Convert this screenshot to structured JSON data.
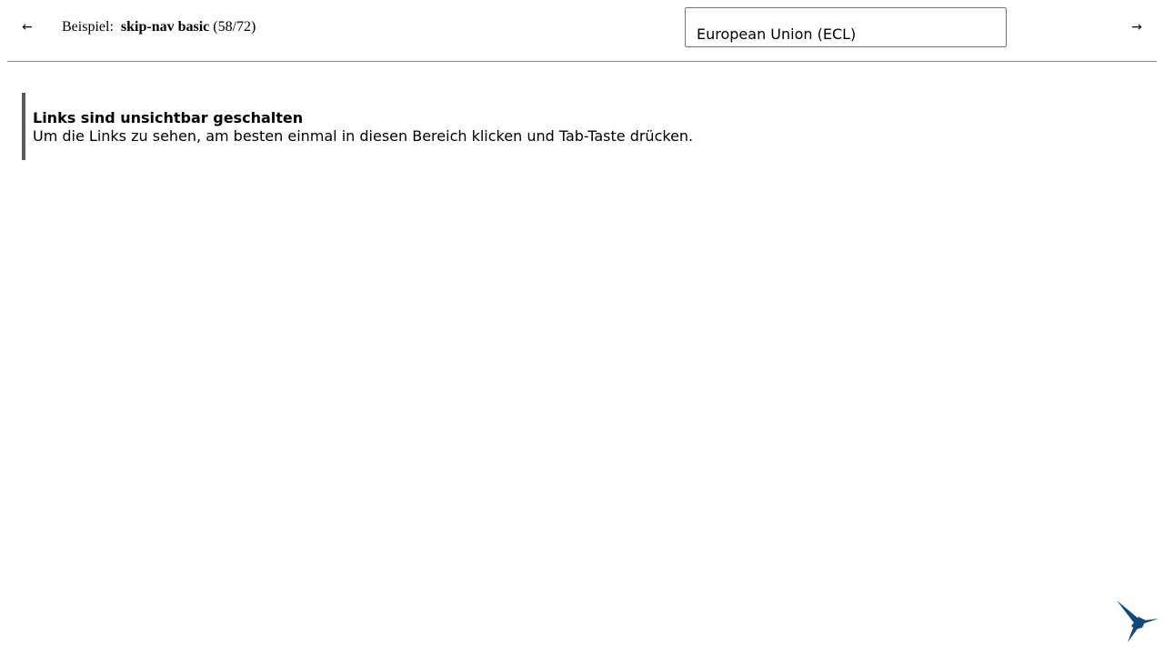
{
  "header": {
    "prev_icon": "←",
    "next_icon": "→",
    "example_label": "Beispiel:",
    "example_name": "skip-nav basic",
    "example_counter": "(58/72)"
  },
  "theme_select": {
    "value": "European Union (ECL)"
  },
  "content": {
    "heading": "Links sind unsichtbar geschalten",
    "text": "Um die Links zu sehen, am besten einmal in diesen Bereich klicken und Tab-Taste drücken."
  },
  "colors": {
    "logo": "#0f4a7a"
  }
}
